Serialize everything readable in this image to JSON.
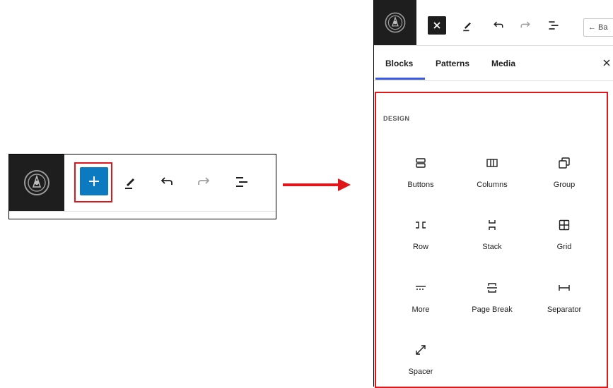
{
  "left_toolbar": {
    "logo": "site-logo-icon",
    "buttons": [
      "plus-icon",
      "pencil-icon",
      "undo-icon",
      "redo-icon",
      "list-view-icon"
    ]
  },
  "panel": {
    "topbar": {
      "close_icon": "close-icon",
      "back_label": "← Ba"
    },
    "tabs": [
      "Blocks",
      "Patterns",
      "Media"
    ],
    "active_tab": "Blocks",
    "section_title": "DESIGN",
    "blocks": [
      {
        "label": "Buttons",
        "icon": "buttons-icon"
      },
      {
        "label": "Columns",
        "icon": "columns-icon"
      },
      {
        "label": "Group",
        "icon": "group-icon"
      },
      {
        "label": "Row",
        "icon": "row-icon"
      },
      {
        "label": "Stack",
        "icon": "stack-icon"
      },
      {
        "label": "Grid",
        "icon": "grid-icon"
      },
      {
        "label": "More",
        "icon": "more-icon"
      },
      {
        "label": "Page Break",
        "icon": "page-break-icon"
      },
      {
        "label": "Separator",
        "icon": "separator-icon"
      },
      {
        "label": "Spacer",
        "icon": "spacer-icon"
      }
    ]
  },
  "colors": {
    "accent": "#0b7ac1",
    "highlight": "#e0161a",
    "tab_underline": "#3858e9",
    "dark": "#1e1e1e"
  }
}
